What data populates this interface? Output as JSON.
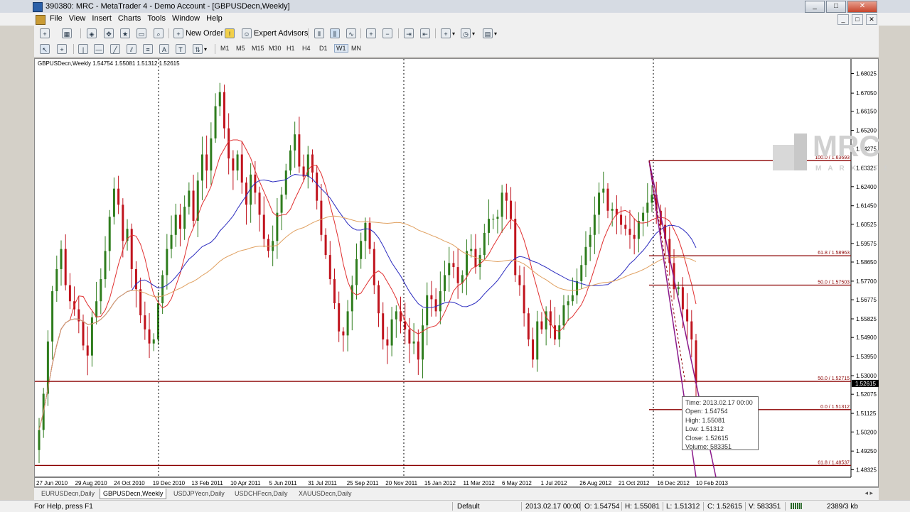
{
  "window": {
    "title": "390380: MRC - MetaTrader 4 - Demo Account - [GBPUSDecn,Weekly]",
    "controls": [
      "_",
      "□",
      "✕"
    ]
  },
  "menu": {
    "items": [
      "File",
      "View",
      "Insert",
      "Charts",
      "Tools",
      "Window",
      "Help"
    ],
    "mdi_controls": [
      "_",
      "□",
      "✕"
    ]
  },
  "toolbar": {
    "new_order": "New Order",
    "expert_advisors": "Expert Advisors",
    "timeframes": [
      "M1",
      "M5",
      "M15",
      "M30",
      "H1",
      "H4",
      "D1",
      "W1",
      "MN"
    ],
    "active_timeframe": "W1",
    "text_tool": "A"
  },
  "chart": {
    "header": "GBPUSDecn,Weekly  1.54754 1.55081 1.51312 1.52615",
    "current_price_label": "1.52615",
    "logo": {
      "big": "MRC",
      "small": "MARKETS"
    },
    "colors": {
      "bull": "#2f7d1e",
      "bear": "#c0141e",
      "ma_red": "#e03030",
      "ma_blue": "#2b2bbf",
      "ma_orange": "#e0a060",
      "fib": "#8b0000",
      "trend": "#8b1a8b"
    }
  },
  "chart_data": {
    "type": "candlestick",
    "symbol": "GBPUSDecn",
    "timeframe": "Weekly",
    "last_bar": {
      "open": 1.54754,
      "high": 1.55081,
      "low": 1.51312,
      "close": 1.52615
    },
    "y_ticks": [
      "1.68025",
      "1.67050",
      "1.66150",
      "1.65200",
      "1.64275",
      "1.63325",
      "1.62400",
      "1.61450",
      "1.60525",
      "1.59575",
      "1.58650",
      "1.57700",
      "1.56775",
      "1.55825",
      "1.54900",
      "1.53950",
      "1.53000",
      "1.52075",
      "1.51125",
      "1.50200",
      "1.49250",
      "1.48325"
    ],
    "x_ticks": [
      "27 Jun 2010",
      "29 Aug 2010",
      "24 Oct 2010",
      "19 Dec 2010",
      "13 Feb 2011",
      "10 Apr 2011",
      "5 Jun 2011",
      "31 Jul 2011",
      "25 Sep 2011",
      "20 Nov 2011",
      "15 Jan 2012",
      "11 Mar 2012",
      "6 May 2012",
      "1 Jul 2012",
      "26 Aug 2012",
      "21 Oct 2012",
      "16 Dec 2012",
      "10 Feb 2013"
    ],
    "ylim": [
      1.4795,
      1.6875
    ],
    "closes": [
      1.503,
      1.521,
      1.547,
      1.572,
      1.583,
      1.593,
      1.575,
      1.567,
      1.563,
      1.557,
      1.545,
      1.54,
      1.559,
      1.567,
      1.578,
      1.592,
      1.609,
      1.623,
      1.615,
      1.597,
      1.603,
      1.583,
      1.573,
      1.56,
      1.553,
      1.546,
      1.548,
      1.566,
      1.58,
      1.593,
      1.6,
      1.61,
      1.603,
      1.614,
      1.622,
      1.607,
      1.627,
      1.64,
      1.632,
      1.648,
      1.664,
      1.671,
      1.653,
      1.638,
      1.632,
      1.64,
      1.626,
      1.615,
      1.63,
      1.621,
      1.61,
      1.598,
      1.592,
      1.597,
      1.611,
      1.62,
      1.632,
      1.642,
      1.65,
      1.634,
      1.629,
      1.64,
      1.631,
      1.617,
      1.6,
      1.59,
      1.578,
      1.566,
      1.552,
      1.55,
      1.562,
      1.575,
      1.588,
      1.597,
      1.606,
      1.593,
      1.575,
      1.561,
      1.548,
      1.545,
      1.558,
      1.562,
      1.557,
      1.553,
      1.546,
      1.547,
      1.538,
      1.555,
      1.57,
      1.568,
      1.562,
      1.572,
      1.58,
      1.586,
      1.584,
      1.576,
      1.58,
      1.592,
      1.593,
      1.584,
      1.59,
      1.601,
      1.608,
      1.608,
      1.609,
      1.621,
      1.617,
      1.608,
      1.58,
      1.575,
      1.561,
      1.548,
      1.538,
      1.557,
      1.553,
      1.562,
      1.555,
      1.548,
      1.555,
      1.565,
      1.567,
      1.57,
      1.577,
      1.585,
      1.594,
      1.6,
      1.61,
      1.621,
      1.623,
      1.612,
      1.613,
      1.61,
      1.605,
      1.603,
      1.6,
      1.598,
      1.607,
      1.611,
      1.616,
      1.62,
      1.612,
      1.605,
      1.598,
      1.586,
      1.573,
      1.574,
      1.563,
      1.557,
      1.548,
      1.526
    ],
    "fibonacci": [
      {
        "label": "100.0 / 1.63693",
        "value": 1.63693
      },
      {
        "label": "61.8 / 1.58963",
        "value": 1.58963
      },
      {
        "label": "50.0 / 1.57503",
        "value": 1.57503
      },
      {
        "label": "50.0 / 1.52715",
        "value": 1.52715
      },
      {
        "label": "0.0 / 1.51312",
        "value": 1.51312
      },
      {
        "label": "61.8 / 1.48537",
        "value": 1.48537
      }
    ],
    "moving_averages": [
      {
        "color": "#e03030"
      },
      {
        "color": "#2b2bbf"
      },
      {
        "color": "#e0a060"
      }
    ]
  },
  "tooltip": {
    "time": "Time: 2013.02.17 00:00",
    "open": "Open: 1.54754",
    "high": "High: 1.55081",
    "low": "Low: 1.51312",
    "close": "Close: 1.52615",
    "volume": "Volume: 583351"
  },
  "chart_tabs": [
    "EURUSDecn,Daily",
    "GBPUSDecn,Weekly",
    "USDJPYecn,Daily",
    "USDCHFecn,Daily",
    "XAUUSDecn,Daily"
  ],
  "active_tab": "GBPUSDecn,Weekly",
  "status": {
    "help": "For Help, press F1",
    "profile": "Default",
    "time": "2013.02.17 00:00",
    "open": "O: 1.54754",
    "high": "H: 1.55081",
    "low": "L: 1.51312",
    "close": "C: 1.52615",
    "volume": "V: 583351",
    "traffic": "2389/3 kb"
  }
}
